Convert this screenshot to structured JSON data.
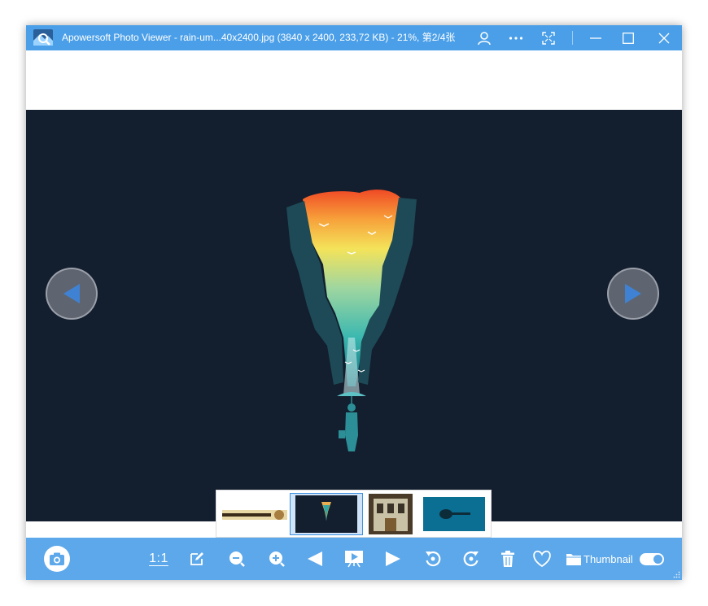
{
  "window": {
    "title": "Apowersoft Photo Viewer - rain-um...40x2400.jpg (3840 x 2400, 233,72 KB) - 21%, 第2/4张",
    "controls": [
      "account-icon",
      "more-icon",
      "fullscreen-icon",
      "minimize-icon",
      "maximize-icon",
      "close-icon"
    ]
  },
  "viewer": {
    "background": "#131e2e",
    "prev_icon": "triangle-left",
    "next_icon": "triangle-right"
  },
  "thumbnails": [
    {
      "name": "thumbnail-1",
      "selected": false
    },
    {
      "name": "thumbnail-2",
      "selected": true
    },
    {
      "name": "thumbnail-3",
      "selected": false
    },
    {
      "name": "thumbnail-4",
      "selected": false
    }
  ],
  "toolbar": {
    "actual_size_label": "1:1",
    "thumbnail_label": "Thumbnail",
    "thumbnail_toggle_on": true,
    "tools": [
      "camera-icon",
      "edit-icon",
      "zoom-out-icon",
      "zoom-in-icon",
      "previous-icon",
      "slideshow-icon",
      "next-icon",
      "rotate-left-icon",
      "rotate-right-icon",
      "delete-icon",
      "favorite-icon",
      "folder-icon"
    ]
  },
  "colors": {
    "titlebar": "#4a9fe8",
    "toolbar": "#5ca8ea",
    "accent": "#3d8fe0"
  }
}
